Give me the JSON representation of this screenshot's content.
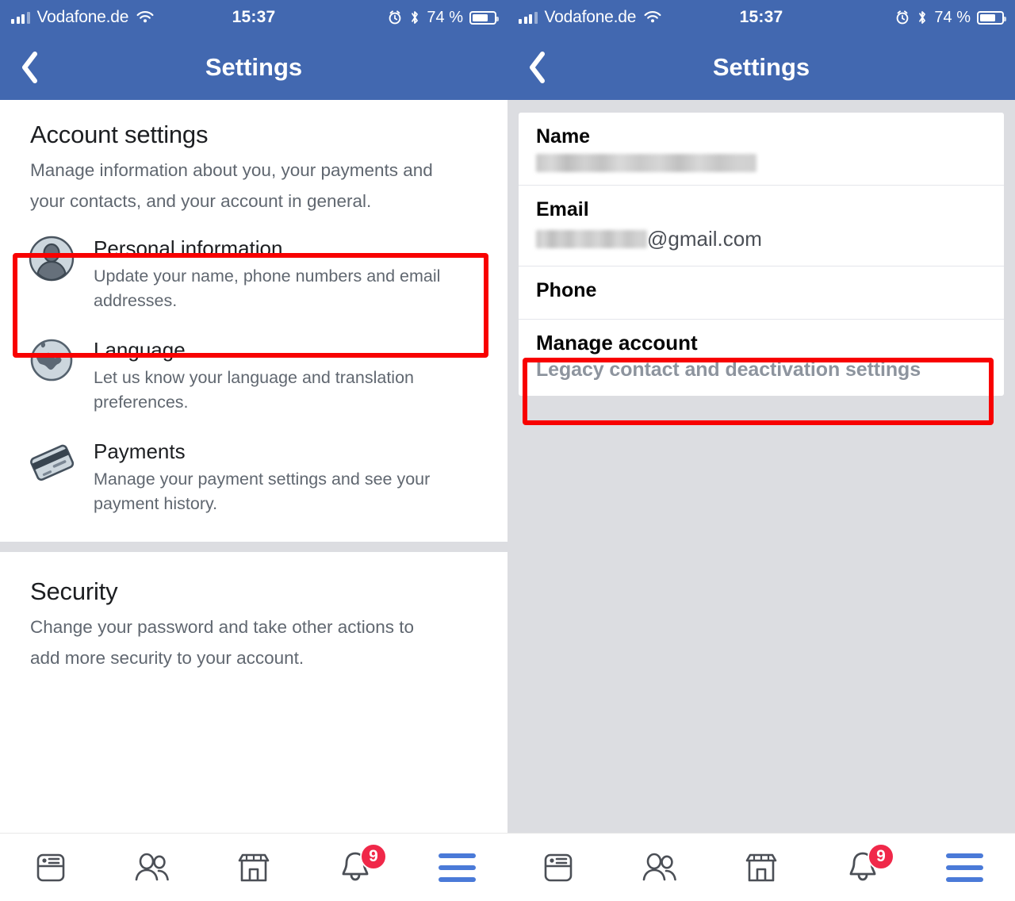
{
  "status_bar": {
    "carrier": "Vodafone.de",
    "time": "15:37",
    "battery_percent": "74 %",
    "icons": [
      "signal-icon",
      "wifi-icon",
      "alarm-icon",
      "bluetooth-icon",
      "battery-icon"
    ]
  },
  "nav": {
    "title": "Settings",
    "back_icon": "chevron-left-icon"
  },
  "left_panel": {
    "account_section": {
      "heading": "Account settings",
      "description": "Manage information about you, your payments and your contacts, and your account in general.",
      "rows": [
        {
          "icon": "person-avatar-icon",
          "title": "Personal information",
          "subtitle": "Update your name, phone numbers and email addresses.",
          "highlighted": true
        },
        {
          "icon": "globe-icon",
          "title": "Language",
          "subtitle": "Let us know your language and translation preferences.",
          "highlighted": false
        },
        {
          "icon": "credit-card-icon",
          "title": "Payments",
          "subtitle": "Manage your payment settings and see your payment history.",
          "highlighted": false
        }
      ]
    },
    "security_section": {
      "heading": "Security",
      "description": "Change your password and take other actions to add more security to your account."
    }
  },
  "right_panel": {
    "rows": [
      {
        "label": "Name",
        "value": "",
        "redacted": true
      },
      {
        "label": "Email",
        "value": "@gmail.com",
        "redacted": true
      },
      {
        "label": "Phone",
        "value": "",
        "redacted": false
      }
    ],
    "manage_account": {
      "title": "Manage account",
      "subtitle": "Legacy contact and deactivation settings",
      "highlighted": true
    }
  },
  "tab_bar": {
    "tabs": [
      {
        "name": "news-feed-tab",
        "icon": "news-feed-icon",
        "badge": ""
      },
      {
        "name": "friends-tab",
        "icon": "friends-icon",
        "badge": ""
      },
      {
        "name": "marketplace-tab",
        "icon": "marketplace-store-icon",
        "badge": ""
      },
      {
        "name": "notifications-tab",
        "icon": "bell-icon",
        "badge": "9"
      },
      {
        "name": "menu-tab",
        "icon": "hamburger-menu-icon",
        "badge": ""
      }
    ]
  },
  "colors": {
    "header_blue": "#4268b0",
    "highlight_red": "#f80101",
    "panel_gray": "#dcdde1",
    "badge_red": "#f02849",
    "menu_blue": "#4a7ad8"
  }
}
